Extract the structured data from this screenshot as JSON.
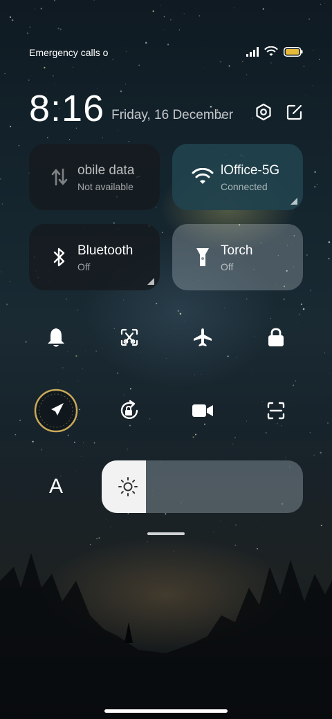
{
  "status_bar": {
    "carrier_text": "Emergency calls o",
    "icons": [
      "signal-icon",
      "wifi-icon",
      "battery-icon"
    ],
    "battery_color": "#e6b93a"
  },
  "clock": {
    "time": "8:16",
    "date": "Friday, 16 December",
    "actions": [
      "settings-icon",
      "edit-icon"
    ]
  },
  "tiles": {
    "mobile_data": {
      "label": "obile data",
      "sublabel": "Not available",
      "icon": "mobile-data-icon"
    },
    "wifi": {
      "label": "lOffice-5G",
      "sublabel": "Connected",
      "icon": "wifi-icon"
    },
    "bluetooth": {
      "label": "Bluetooth",
      "sublabel": "Off",
      "icon": "bluetooth-icon"
    },
    "torch": {
      "label": "Torch",
      "sublabel": "Off",
      "icon": "torch-icon"
    }
  },
  "toggles_row1": [
    "bell-icon",
    "screenshot-icon",
    "airplane-icon",
    "lock-icon"
  ],
  "toggles_row2": [
    "location-icon",
    "rotation-lock-icon",
    "video-camera-icon",
    "scan-icon"
  ],
  "font_button": {
    "label": "A"
  },
  "brightness": {
    "level": 0.22
  },
  "colors": {
    "tile_active": "#21424d",
    "tile_dark": "#16191e"
  }
}
